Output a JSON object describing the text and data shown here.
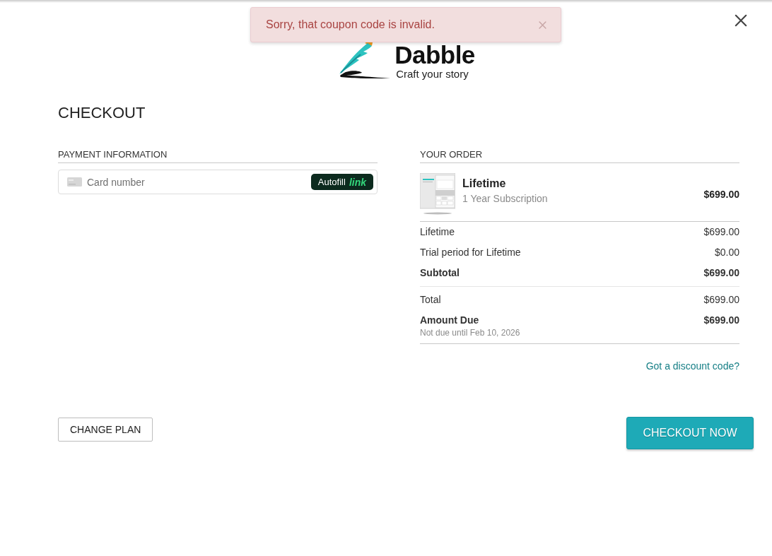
{
  "toast": {
    "message": "Sorry, that coupon code is invalid."
  },
  "logo": {
    "name": "Dabble",
    "tagline": "Craft your story"
  },
  "heading": "CHECKOUT",
  "payment": {
    "title": "PAYMENT INFORMATION",
    "card_field": {
      "placeholder": "Card number"
    },
    "autofill_button": {
      "label": "Autofill",
      "brand": "link"
    }
  },
  "order": {
    "title": "YOUR ORDER",
    "product": {
      "name": "Lifetime",
      "description": "1 Year Subscription",
      "price": "$699.00"
    },
    "groups": [
      {
        "lines": [
          {
            "label": "Lifetime",
            "amount": "$699.00",
            "bold": false
          },
          {
            "label": "Trial period for Lifetime",
            "amount": "$0.00",
            "bold": false
          },
          {
            "label": "Subtotal",
            "amount": "$699.00",
            "bold": true
          }
        ]
      },
      {
        "lines": [
          {
            "label": "Total",
            "amount": "$699.00",
            "bold": false
          },
          {
            "label": "Amount Due",
            "amount": "$699.00",
            "bold": true,
            "note": "Not due until Feb 10, 2026"
          }
        ]
      }
    ]
  },
  "discount_link": "Got a discount code?",
  "buttons": {
    "change_plan": "CHANGE PLAN",
    "checkout": "CHECKOUT NOW"
  }
}
